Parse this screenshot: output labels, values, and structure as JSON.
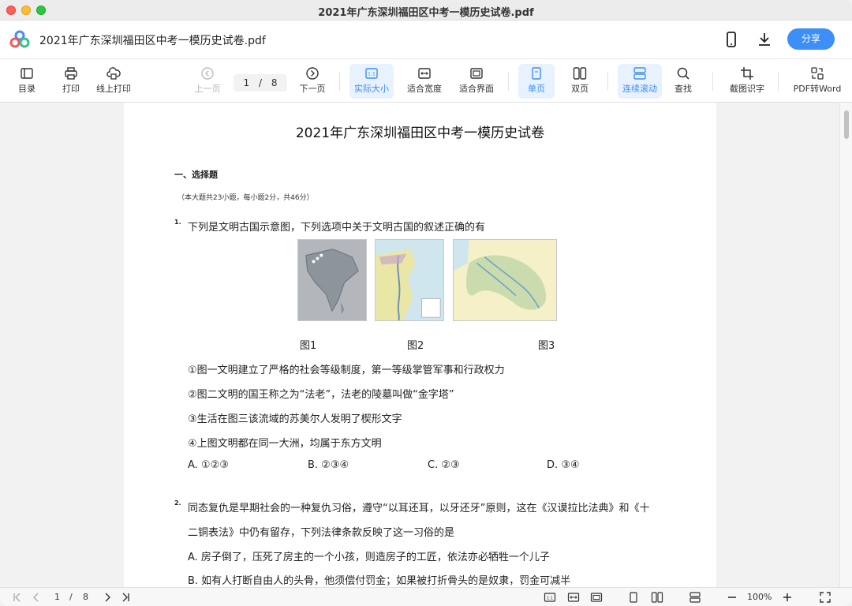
{
  "window": {
    "title": "2021年广东深圳福田区中考一模历史试卷.pdf"
  },
  "header": {
    "doc_title": "2021年广东深圳福田区中考一模历史试卷.pdf",
    "share_label": "分享"
  },
  "toolbar": {
    "toc": "目录",
    "print": "打印",
    "online_print": "线上打印",
    "prev_page": "上一页",
    "current_page": "1",
    "page_sep": "/",
    "total_pages": "8",
    "next_page": "下一页",
    "actual_size": "实际大小",
    "fit_width": "适合宽度",
    "fit_page": "适合界面",
    "single_page": "单页",
    "double_page": "双页",
    "continuous_scroll": "连续滚动",
    "find": "查找",
    "screenshot_ocr": "截图识字",
    "pdf_to_word": "PDF转Word"
  },
  "document": {
    "title": "2021年广东深圳福田区中考一模历史试卷",
    "section_title": "一、选择题",
    "section_note": "（本大题共23小题，每小题2分，共46分）",
    "q1": {
      "num": "1.",
      "stem": "下列是文明古国示意图，下列选项中关于文明古国的叙述正确的有",
      "fig1": "图1",
      "fig2": "图2",
      "fig3": "图3",
      "s1": "①图一文明建立了严格的社会等级制度，第一等级掌管军事和行政权力",
      "s2": "②图二文明的国王称之为“法老”，法老的陵墓叫做“金字塔”",
      "s3": "③生活在图三该流域的苏美尔人发明了楔形文字",
      "s4": "④上图文明都在同一大洲，均属于东方文明",
      "optA": "A. ①②③",
      "optB": "B. ②③④",
      "optC": "C. ②③",
      "optD": "D. ③④"
    },
    "q2": {
      "num": "2.",
      "line1": "同态复仇是早期社会的一种复仇习俗，遵守“以耳还耳，以牙还牙”原则，这在《汉谟拉比法典》和《十",
      "line2": "二铜表法》中仍有留存，下列法律条款反映了这一习俗的是",
      "optA": "A. 房子倒了，压死了房主的一个小孩，则造房子的工匠，依法亦必牺牲一个儿子",
      "optB": "B. 如有人打断自由人的头骨，他须偿付罚金；如果被打折骨头的是奴隶，罚金可减半"
    }
  },
  "bottombar": {
    "current_page": "1",
    "page_sep": "/",
    "total_pages": "8",
    "zoom": "100%"
  },
  "colors": {
    "accent": "#3d8ef7",
    "active_bg": "#e8f1fe"
  }
}
